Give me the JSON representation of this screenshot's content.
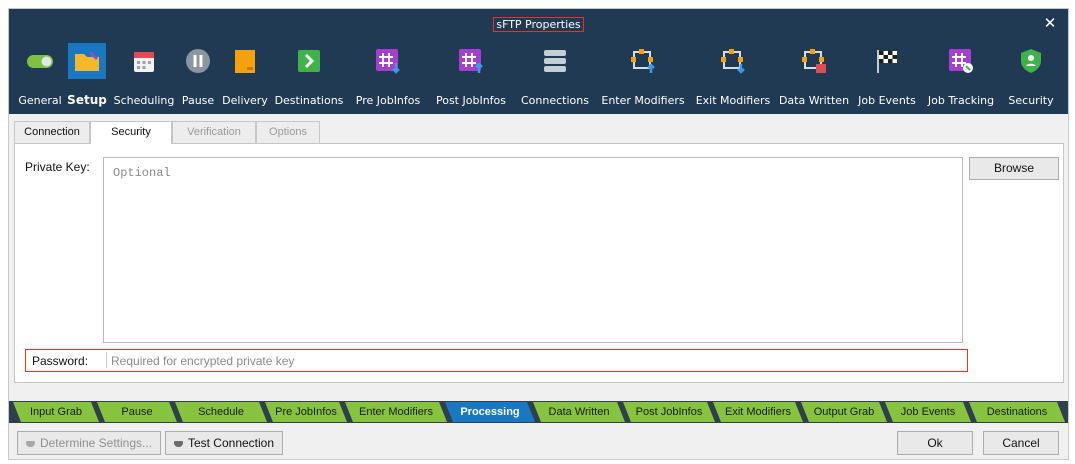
{
  "window": {
    "title": "sFTP Properties",
    "close_glyph": "✕"
  },
  "toolbar": {
    "items": [
      {
        "label": "General",
        "icon": "toggle-icon",
        "color": "#7fc241"
      },
      {
        "label": "Setup",
        "icon": "folder-icon",
        "color": "#f5b72c",
        "active": true
      },
      {
        "label": "Scheduling",
        "icon": "calendar-icon",
        "color": "#e24a55"
      },
      {
        "label": "Pause",
        "icon": "pause-icon",
        "color": "#8a96a0"
      },
      {
        "label": "Delivery",
        "icon": "package-icon",
        "color": "#f4a10a"
      },
      {
        "label": "Destinations",
        "icon": "arrow-right-icon",
        "color": "#3fb24a"
      },
      {
        "label": "Pre JobInfos",
        "icon": "hash-down-icon",
        "color": "#a53fd1"
      },
      {
        "label": "Post JobInfos",
        "icon": "hash-up-icon",
        "color": "#a53fd1"
      },
      {
        "label": "Connections",
        "icon": "database-icon",
        "color": "#c4ccd4"
      },
      {
        "label": "Enter Modifiers",
        "icon": "modifier-enter-icon",
        "color": "#f4a10a"
      },
      {
        "label": "Exit Modifiers",
        "icon": "modifier-exit-icon",
        "color": "#f4a10a"
      },
      {
        "label": "Data Written",
        "icon": "data-written-icon",
        "color": "#f4a10a"
      },
      {
        "label": "Job Events",
        "icon": "checkered-flag-icon",
        "color": "#ffffff"
      },
      {
        "label": "Job Tracking",
        "icon": "hash-tracking-icon",
        "color": "#a53fd1"
      },
      {
        "label": "Security",
        "icon": "shield-icon",
        "color": "#3fb24a"
      }
    ]
  },
  "tabs": [
    {
      "label": "Connection",
      "state": "normal"
    },
    {
      "label": "Security",
      "state": "active"
    },
    {
      "label": "Verification",
      "state": "disabled"
    },
    {
      "label": "Options",
      "state": "disabled"
    }
  ],
  "security": {
    "private_key_label": "Private Key:",
    "private_key_placeholder": "Optional",
    "browse_label": "Browse",
    "password_label": "Password:",
    "password_placeholder": "Required for encrypted private key"
  },
  "workflow": {
    "steps": [
      "Input Grab",
      "Pause",
      "Schedule",
      "Pre JobInfos",
      "Enter Modifiers",
      "Processing",
      "Data Written",
      "Post JobInfos",
      "Exit Modifiers",
      "Output Grab",
      "Job Events",
      "Destinations"
    ],
    "current": "Processing"
  },
  "footer": {
    "determine_label": "Determine Settings...",
    "test_label": "Test Connection",
    "ok_label": "Ok",
    "cancel_label": "Cancel"
  },
  "colors": {
    "title_bar": "#1f3a52",
    "accent": "#1a78c2",
    "step_green": "#86c440",
    "highlight_red": "#e5322d"
  }
}
